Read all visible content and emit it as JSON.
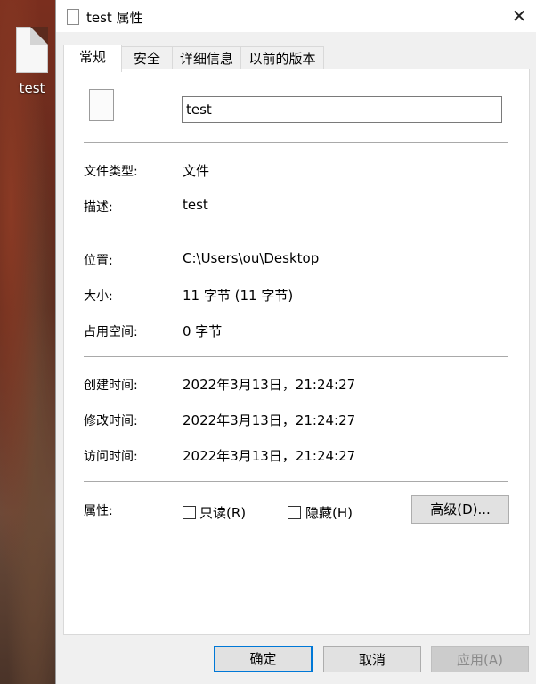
{
  "desktop": {
    "icon_label": "test"
  },
  "window": {
    "title": "test 属性",
    "close_glyph": "✕"
  },
  "tabs": [
    {
      "label": "常规",
      "active": true
    },
    {
      "label": "安全"
    },
    {
      "label": "详细信息"
    },
    {
      "label": "以前的版本"
    }
  ],
  "general": {
    "name_value": "test",
    "type_label": "文件类型:",
    "type_value": "文件",
    "desc_label": "描述:",
    "desc_value": "test",
    "location_label": "位置:",
    "location_value": "C:\\Users\\ou\\Desktop",
    "size_label": "大小:",
    "size_value": "11 字节 (11 字节)",
    "disk_label": "占用空间:",
    "disk_value": "0 字节",
    "created_label": "创建时间:",
    "created_value": "2022年3月13日，21:24:27",
    "modified_label": "修改时间:",
    "modified_value": "2022年3月13日，21:24:27",
    "accessed_label": "访问时间:",
    "accessed_value": "2022年3月13日，21:24:27",
    "attr_label": "属性:",
    "readonly_label": "只读(R)",
    "hidden_label": "隐藏(H)",
    "advanced_label": "高级(D)..."
  },
  "footer": {
    "ok_label": "确定",
    "cancel_label": "取消",
    "apply_label": "应用(A)"
  },
  "colors": {
    "accent": "#0078d7",
    "panel_bg": "#ffffff",
    "window_bg": "#f0f0f0"
  }
}
